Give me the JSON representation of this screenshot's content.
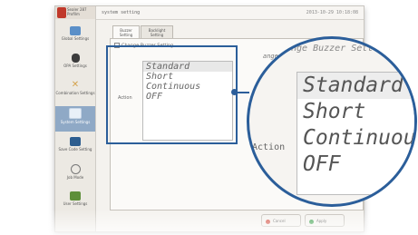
{
  "window": {
    "title": "system setting",
    "timestamp": "2013-10-29 10:18:08"
  },
  "sidebar": {
    "header_text": "Sealer 287\nProfilm",
    "items": [
      {
        "label": "Global Settings",
        "icon": "globe-icon",
        "color": "#5a8fc8"
      },
      {
        "label": "OPA Settings",
        "icon": "flask-icon",
        "color": "#3c3c3c"
      },
      {
        "label": "Combination Settings",
        "icon": "tools-icon",
        "color": "#d4a24c"
      },
      {
        "label": "System Settings",
        "icon": "monitor-icon",
        "color": "#e9f0f8"
      },
      {
        "label": "Save Code Setting",
        "icon": "code-icon",
        "color": "#2c5d8f"
      },
      {
        "label": "Job Mode",
        "icon": "gear-icon",
        "color": "#777777"
      },
      {
        "label": "User Settings",
        "icon": "users-icon",
        "color": "#5e8f3a"
      }
    ]
  },
  "tabs": [
    {
      "label": "Buzzer Setting"
    },
    {
      "label": "Backlight Setting"
    }
  ],
  "panel": {
    "checkbox_label": "Change Buzzer Setting",
    "action_label": "Action",
    "options": [
      "Standard",
      "Short",
      "Continuous",
      "OFF"
    ],
    "selected_option": "Standard",
    "right_label": "ange Buzzer Sett"
  },
  "zoom": {
    "header": "ange Buzzer Sett",
    "action_label": "Action",
    "options": [
      "Standard",
      "Short",
      "Continuous",
      "OFF"
    ]
  },
  "buttons": {
    "cancel": {
      "label": "Cancel",
      "color": "#d24a3c"
    },
    "apply": {
      "label": "Apply",
      "color": "#3aa04a"
    }
  },
  "colors": {
    "accent": "#2b5e9a"
  }
}
